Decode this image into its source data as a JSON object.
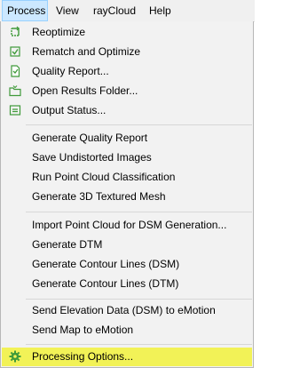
{
  "menubar": {
    "items": [
      "Process",
      "View",
      "rayCloud",
      "Help"
    ]
  },
  "menu": {
    "group1": [
      {
        "label": "Reoptimize",
        "icon": "reoptimize-icon"
      },
      {
        "label": "Rematch and Optimize",
        "icon": "rematch-icon"
      },
      {
        "label": "Quality Report...",
        "icon": "report-document-icon"
      },
      {
        "label": "Open Results Folder...",
        "icon": "folder-icon"
      },
      {
        "label": "Output Status...",
        "icon": "output-status-icon"
      }
    ],
    "group2": [
      {
        "label": "Generate Quality Report"
      },
      {
        "label": "Save Undistorted Images"
      },
      {
        "label": "Run Point Cloud Classification"
      },
      {
        "label": "Generate 3D Textured Mesh"
      }
    ],
    "group3": [
      {
        "label": "Import Point Cloud for DSM Generation..."
      },
      {
        "label": "Generate DTM"
      },
      {
        "label": "Generate Contour Lines (DSM)"
      },
      {
        "label": "Generate Contour Lines (DTM)"
      }
    ],
    "group4": [
      {
        "label": "Send Elevation Data (DSM) to eMotion"
      },
      {
        "label": "Send Map to eMotion"
      }
    ],
    "group5": [
      {
        "label": "Processing Options...",
        "icon": "gear-icon"
      }
    ]
  },
  "colors": {
    "highlight": "#f2f257",
    "icon_green": "#3f9a3a",
    "menubar_active": "#cce8ff"
  }
}
